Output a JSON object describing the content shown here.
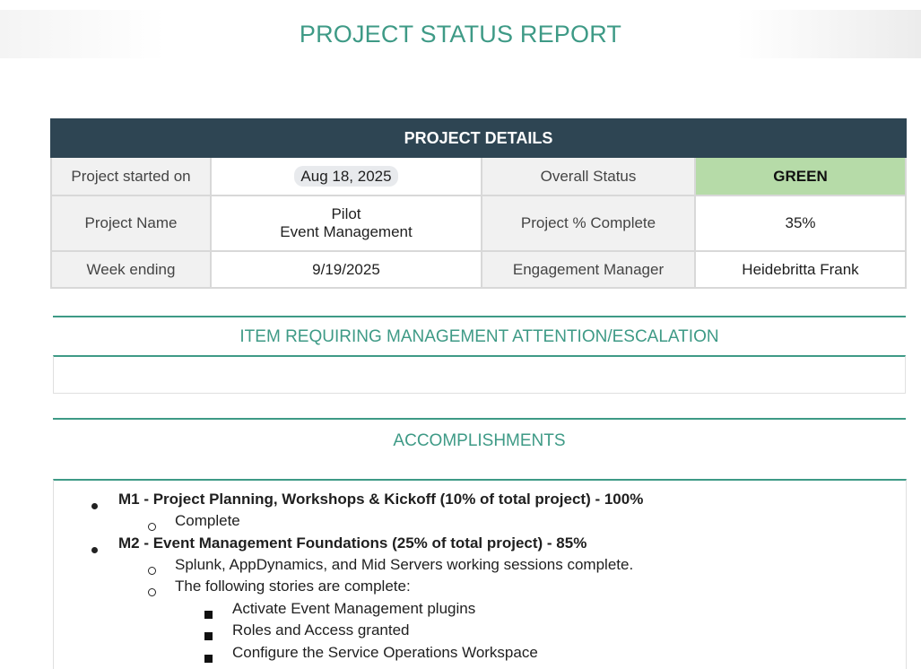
{
  "report_title": "PROJECT STATUS REPORT",
  "project_details": {
    "header": "PROJECT DETAILS",
    "rows": [
      {
        "label1": "Project started on",
        "value1": "Aug 18, 2025",
        "label2": "Overall Status",
        "value2": "GREEN"
      },
      {
        "label1": "Project Name",
        "value1_line1": "Pilot",
        "value1_line2": "Event Management",
        "label2": "Project % Complete",
        "value2": "35%"
      },
      {
        "label1": "Week ending",
        "value1": "9/19/2025",
        "label2": "Engagement Manager",
        "value2": "Heidebritta Frank"
      }
    ],
    "status_color": "#b6dba8"
  },
  "escalation": {
    "header": "ITEM REQUIRING MANAGEMENT ATTENTION/ESCALATION",
    "content": ""
  },
  "accomplishments": {
    "header": "ACCOMPLISHMENTS",
    "items": [
      {
        "title": "M1 - Project Planning, Workshops & Kickoff  (10% of total project) - 100%",
        "sub": [
          "Complete"
        ]
      },
      {
        "title": "M2 - Event Management Foundations (25% of total project) - 85%",
        "sub": [
          "Splunk, AppDynamics, and Mid Servers  working sessions complete.",
          "The following stories are complete:"
        ],
        "subsub": [
          "Activate Event Management plugins",
          "Roles and Access granted",
          "Configure the Service Operations Workspace"
        ]
      }
    ]
  },
  "colors": {
    "accent": "#3e9a86",
    "header_bg": "#2e4553"
  }
}
